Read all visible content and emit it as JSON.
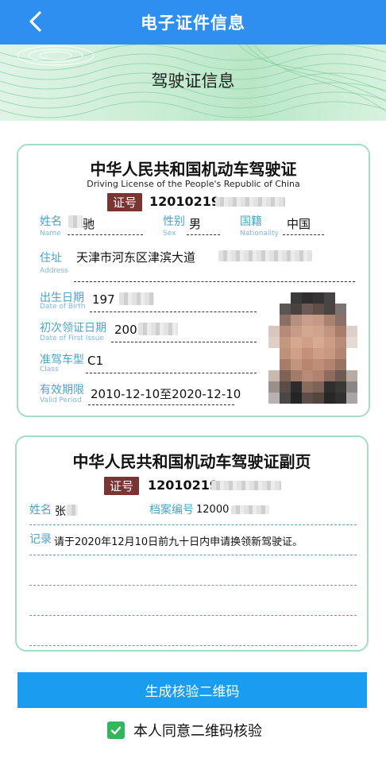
{
  "header": {
    "title": "电子证件信息"
  },
  "banner": {
    "title": "驾驶证信息"
  },
  "license": {
    "title_cn": "中华人民共和国机动车驾驶证",
    "title_en": "Driving License of the People's Republic of China",
    "id_label": "证号",
    "id_value": "12010219",
    "name_label": "姓名",
    "name_label_en": "Name",
    "name_value": "驰",
    "sex_label": "性别",
    "sex_label_en": "Sex",
    "sex_value": "男",
    "nationality_label": "国籍",
    "nationality_label_en": "Nationality",
    "nationality_value": "中国",
    "address_label": "住址",
    "address_label_en": "Address",
    "address_value": "天津市河东区津滨大道",
    "dob_label": "出生日期",
    "dob_label_en": "Date of Birth",
    "dob_value": "197",
    "first_issue_label": "初次领证日期",
    "first_issue_label_en": "Date of First Issue",
    "first_issue_value": "200",
    "class_label": "准驾车型",
    "class_label_en": "Class",
    "class_value": "C1",
    "valid_label": "有效期限",
    "valid_label_en": "Valid Period",
    "valid_value": "2010-12-10至2020-12-10"
  },
  "duplicate": {
    "title": "中华人民共和国机动车驾驶证副页",
    "id_label": "证号",
    "id_value": "12010219",
    "name_label": "姓名",
    "name_value": "张",
    "file_no_label": "档案编号",
    "file_no_value": "12000",
    "record_label": "记录",
    "record_value": "请于2020年12月10日前九十日内申请换领新驾驶证。"
  },
  "actions": {
    "generate_button": "生成核验二维码",
    "agree_text": "本人同意二维码核验"
  },
  "colors": {
    "header_bg": "#2f8ff0",
    "button_bg": "#1a9cf0",
    "card_border": "#a6dcc3",
    "label_blue": "#4aa3c9",
    "badge_bg": "#7a3434",
    "check_green": "#33b55a"
  }
}
